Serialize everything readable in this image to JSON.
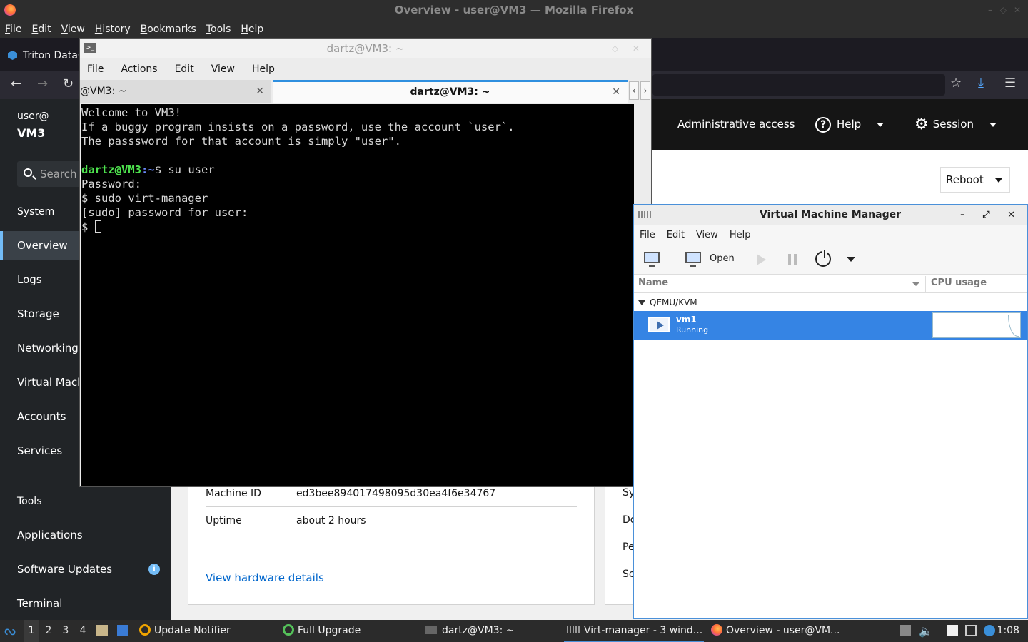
{
  "firefox": {
    "window_title": "Overview - user@VM3 — Mozilla Firefox",
    "menu": [
      "File",
      "Edit",
      "View",
      "History",
      "Bookmarks",
      "Tools",
      "Help"
    ],
    "tab_title": "Triton DataC"
  },
  "cockpit": {
    "header": {
      "admin_label": "Administrative access",
      "help_label": "Help",
      "session_label": "Session"
    },
    "sidebar": {
      "user": "user@",
      "host": "VM3",
      "search_placeholder": "Search",
      "section_system": "System",
      "items": [
        "Overview",
        "Logs",
        "Storage",
        "Networking",
        "Virtual Mach",
        "Accounts",
        "Services"
      ],
      "section_tools": "Tools",
      "tools": [
        "Applications",
        "Software Updates",
        "Terminal"
      ],
      "updates_badge": "i"
    },
    "reboot_label": "Reboot",
    "info": {
      "machine_id_label": "Machine ID",
      "machine_id": "ed3bee894017498095d30ea4f6e34767",
      "uptime_label": "Uptime",
      "uptime": "about 2 hours",
      "hw_link": "View hardware details"
    },
    "card2_labels": [
      "Sy",
      "Do",
      "Pe",
      "Se"
    ]
  },
  "terminal": {
    "title": "dartz@VM3: ~",
    "menu": [
      "File",
      "Actions",
      "Edit",
      "View",
      "Help"
    ],
    "tabs": [
      "@VM3: ~",
      "dartz@VM3: ~"
    ],
    "lines": [
      "Welcome to VM3!",
      "If a buggy program insists on a password, use the account `user`.",
      "The passsword for that account is simply \"user\".",
      "",
      "",
      "Password:",
      "$ sudo virt-manager",
      "[sudo] password for user:"
    ],
    "prompt_user": "dartz@VM3",
    "prompt_path": ":~",
    "prompt_cmd": "$ su user",
    "last_prompt": "$ "
  },
  "vmm": {
    "title": "Virtual Machine Manager",
    "menu": [
      "File",
      "Edit",
      "View",
      "Help"
    ],
    "open_label": "Open",
    "col_name": "Name",
    "col_cpu": "CPU usage",
    "group": "QEMU/KVM",
    "vm": {
      "name": "vm1",
      "status": "Running"
    }
  },
  "taskbar": {
    "workspaces": [
      "1",
      "2",
      "3",
      "4"
    ],
    "tasks": [
      "Update Notifier",
      "Full Upgrade",
      "dartz@VM3: ~",
      "Virt-manager - 3 wind...",
      "Overview - user@VM..."
    ],
    "clock": "1:08"
  }
}
